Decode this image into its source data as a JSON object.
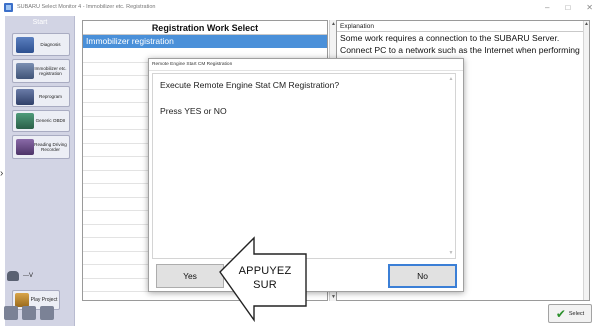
{
  "window": {
    "title": "SUBARU Select Monitor 4 - Immobilizer etc. Registration",
    "controls": [
      "–",
      "□",
      "✕"
    ]
  },
  "sidebar": {
    "start_label": "Start",
    "items": [
      {
        "label": "Diagnosis",
        "icon": "diagnosis-icon"
      },
      {
        "label": "Immobilizer etc. registration",
        "icon": "immobilizer-icon"
      },
      {
        "label": "Reprogram",
        "icon": "reprogram-icon"
      },
      {
        "label": "Generic OBDII",
        "icon": "obd-icon"
      },
      {
        "label": "Reading Driving Recorder",
        "icon": "recorder-icon"
      }
    ],
    "status_text": "---V",
    "play_label": "Play Project"
  },
  "registration": {
    "header": "Registration Work Select",
    "selected_item": "Immobilizer registration"
  },
  "explanation": {
    "header": "Explanation",
    "line1": "Some work requires a connection to the SUBARU Server.",
    "line2": "Connect PC to a network such as the Internet when performing"
  },
  "select_button": "Select",
  "dialog": {
    "title": "Remote Engine Start CM Registration",
    "question": "Execute Remote Engine Stat CM Registration?",
    "instruction": "Press YES or NO",
    "yes_label": "Yes",
    "no_label": "No"
  },
  "callout": {
    "line1": "APPUYEZ",
    "line2": "SUR"
  },
  "colors": {
    "selection_blue": "#4a90d9",
    "sidebar_bg": "#d2d4e4",
    "focus_border": "#3b7fd6"
  }
}
